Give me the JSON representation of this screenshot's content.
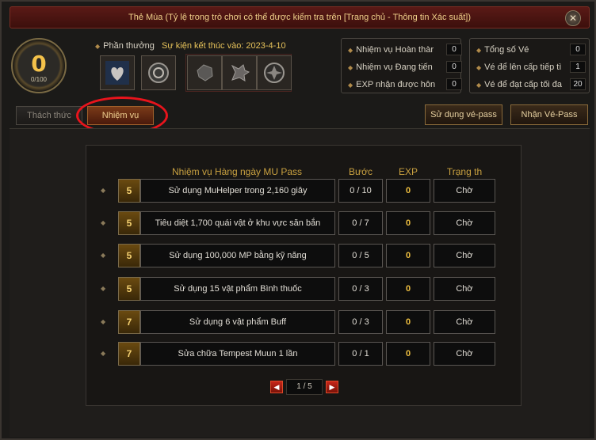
{
  "window": {
    "title": "Thẻ Mùa (Tỷ lệ trong trò chơi có thể được kiểm tra trên [Trang chủ - Thông tin Xác suất])",
    "close_symbol": "✕"
  },
  "level": {
    "value": "0",
    "progress": "0/100"
  },
  "rewards": {
    "label": "Phần thưởng",
    "event_end": "Sự kiện kết thúc vào: 2023-4-10"
  },
  "stats_left": [
    {
      "label": "Nhiệm vụ Hoàn thàr",
      "value": "0"
    },
    {
      "label": "Nhiệm vụ Đang tiến",
      "value": "0"
    },
    {
      "label": "EXP nhận được hôn",
      "value": "0"
    }
  ],
  "stats_right": [
    {
      "label": "Tổng số Vé",
      "value": "0"
    },
    {
      "label": "Vé để lên cấp tiếp tì",
      "value": "1"
    },
    {
      "label": "Vé để đạt cấp tối đa",
      "value": "20"
    }
  ],
  "tabs": [
    {
      "label": "Thách thức"
    },
    {
      "label": "Nhiệm vụ"
    }
  ],
  "buttons": {
    "use_pass": "Sử dụng vé-pass",
    "get_pass": "Nhận Vé-Pass"
  },
  "table": {
    "headers": {
      "title": "Nhiệm vụ Hàng ngày MU Pass",
      "step": "Bước",
      "exp": "EXP",
      "status": "Trạng th"
    },
    "rows": [
      {
        "level": "5",
        "desc": "Sử dụng MuHelper trong 2,160 giây",
        "step": "0 / 10",
        "exp": "0",
        "status": "Chờ"
      },
      {
        "level": "5",
        "desc": "Tiêu diệt 1,700 quái vật ở khu vực săn bắn",
        "step": "0 / 7",
        "exp": "0",
        "status": "Chờ"
      },
      {
        "level": "5",
        "desc": "Sử dụng 100,000 MP bằng kỹ năng",
        "step": "0 / 5",
        "exp": "0",
        "status": "Chờ"
      },
      {
        "level": "5",
        "desc": "Sử dụng 15 vật phẩm Bình thuốc",
        "step": "0 / 3",
        "exp": "0",
        "status": "Chờ"
      },
      {
        "level": "7",
        "desc": "Sử dụng 6 vật phẩm Buff",
        "step": "0 / 3",
        "exp": "0",
        "status": "Chờ"
      },
      {
        "level": "7",
        "desc": "Sửa chữa Tempest Muun 1 lần",
        "step": "0 / 1",
        "exp": "0",
        "status": "Chờ"
      }
    ]
  },
  "pager": {
    "value": "1 / 5",
    "prev": "◀",
    "next": "▶"
  },
  "colors": {
    "accent_gold": "#f0c040",
    "title_red": "#5a1a16",
    "highlight_ring": "#e8141c"
  }
}
